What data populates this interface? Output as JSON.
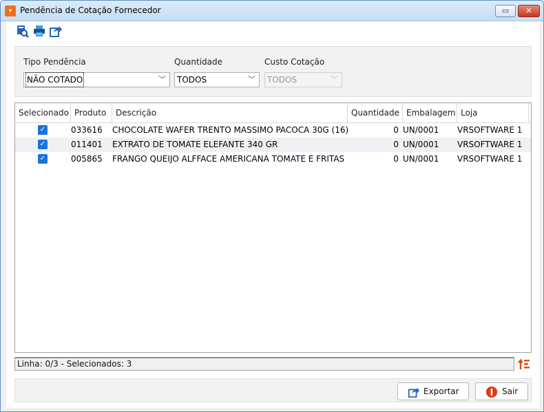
{
  "window": {
    "title": "Pendência de Cotação Fornecedor",
    "restore_glyph": "▭",
    "close_glyph": "✕"
  },
  "toolbar": {
    "icons": [
      "search-preview-icon",
      "print-icon",
      "export-icon"
    ]
  },
  "filters": {
    "tipo_pendencia": {
      "label": "Tipo Pendência",
      "value": "NÃO COTADO"
    },
    "quantidade": {
      "label": "Quantidade",
      "value": "TODOS"
    },
    "custo_cotacao": {
      "label": "Custo Cotação",
      "value": "TODOS",
      "disabled": true
    }
  },
  "table": {
    "columns": [
      "Selecionado",
      "Produto",
      "Descrição",
      "Quantidade",
      "Embalagem",
      "Loja"
    ],
    "rows": [
      {
        "selecionado": true,
        "produto": "033616",
        "descricao": "CHOCOLATE WAFER TRENTO MASSIMO PACOCA 30G (16)",
        "quantidade": "0",
        "embalagem": "UN/0001",
        "loja": "VRSOFTWARE 1"
      },
      {
        "selecionado": true,
        "produto": "011401",
        "descricao": "EXTRATO DE TOMATE ELEFANTE 340 GR",
        "quantidade": "0",
        "embalagem": "UN/0001",
        "loja": "VRSOFTWARE 1"
      },
      {
        "selecionado": true,
        "produto": "005865",
        "descricao": "FRANGO QUEIJO ALFFACE AMERICANA TOMATE E FRITAS",
        "quantidade": "0",
        "embalagem": "UN/0001",
        "loja": "VRSOFTWARE 1"
      }
    ]
  },
  "status": {
    "text": "Linha: 0/3 - Selecionados: 3"
  },
  "buttons": {
    "exportar": "Exportar",
    "sair": "Sair"
  },
  "colors": {
    "accent": "#f07020",
    "checkbox": "#1a73d8",
    "close": "#c2391f",
    "sair": "#e03a12"
  }
}
